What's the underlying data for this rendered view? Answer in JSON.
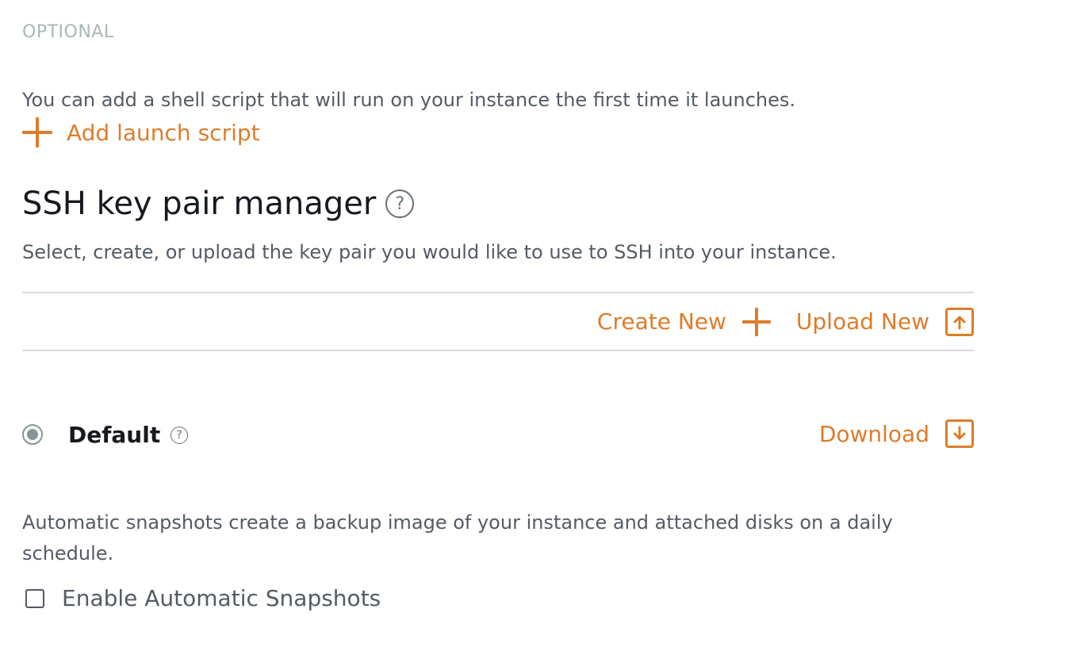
{
  "optional_label": "OPTIONAL",
  "launch_script": {
    "description": "You can add a shell script that will run on your instance the first time it launches.",
    "add_label": "Add launch script"
  },
  "ssh": {
    "title": "SSH key pair manager",
    "help_glyph": "?",
    "description": "Select, create, or upload the key pair you would like to use to SSH into your instance.",
    "create_label": "Create New",
    "upload_label": "Upload New"
  },
  "key_pair": {
    "name": "Default",
    "selected": true,
    "help_glyph": "?",
    "download_label": "Download"
  },
  "snapshots": {
    "description": "Automatic snapshots create a backup image of your instance and attached disks on a daily schedule.",
    "enable_label": "Enable Automatic Snapshots",
    "checked": false
  },
  "icons": {
    "add": "plus-icon",
    "help": "help-circle-icon",
    "upload": "upload-box-icon",
    "download": "download-box-icon"
  },
  "colors": {
    "accent": "#dd7c2a",
    "text": "#545b64",
    "heading": "#16191f",
    "muted": "#aab7b8",
    "divider": "#d5dbdb"
  }
}
